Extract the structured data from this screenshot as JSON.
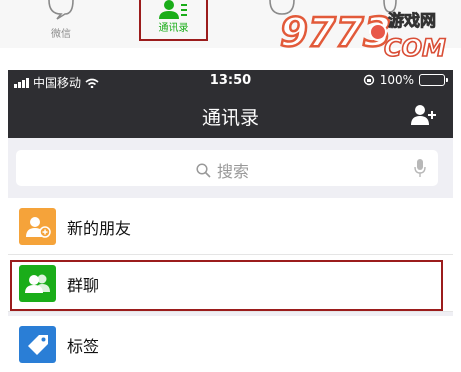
{
  "tabbar": {
    "tabs": [
      {
        "label": "微信",
        "icon": "chat-bubble-icon"
      },
      {
        "label": "通讯录",
        "icon": "contacts-icon",
        "active": true
      },
      {
        "label": "",
        "icon": "compass-icon"
      },
      {
        "label": "",
        "icon": "person-icon"
      }
    ]
  },
  "watermark": {
    "text": "9773",
    "site": "游戏网",
    "domain": "COM"
  },
  "statusbar": {
    "carrier": "中国移动",
    "time": "13:50",
    "battery": "100%"
  },
  "navbar": {
    "title": "通讯录",
    "action_icon": "add-friend-icon"
  },
  "search": {
    "placeholder": "搜索"
  },
  "list": [
    {
      "label": "新的朋友",
      "icon": "new-friend-icon",
      "color": "#f5a33a"
    },
    {
      "label": "群聊",
      "icon": "group-chat-icon",
      "color": "#1aad19"
    },
    {
      "label": "标签",
      "icon": "tag-icon",
      "color": "#2a7ed6"
    }
  ],
  "colors": {
    "accent": "#1aad19",
    "highlight": "#9b1c1c",
    "navbar": "#2e2e32"
  }
}
